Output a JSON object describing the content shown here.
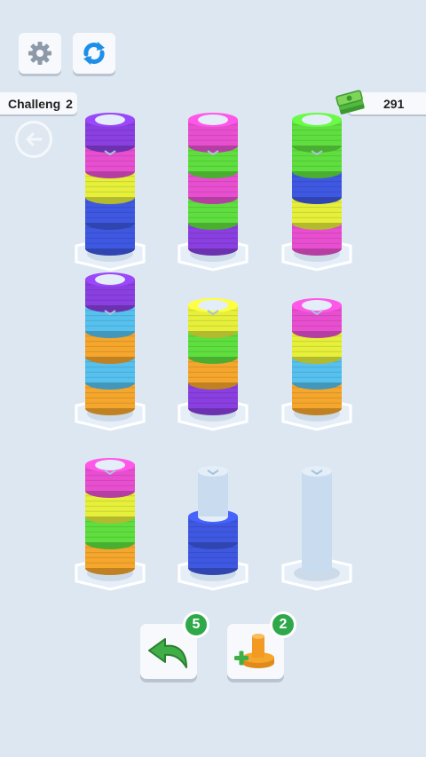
{
  "header": {
    "settings_icon": "gear-icon",
    "refresh_icon": "refresh-icon",
    "level_label": "Challeng",
    "level_number": "2",
    "cash_icon": "money-stack-icon",
    "cash_amount": "291",
    "back_icon": "arrow-left-icon"
  },
  "colors": {
    "purple": "#8a3fe0",
    "pink": "#e84fd0",
    "yellow": "#e6ef3a",
    "blue": "#3f58e2",
    "green": "#5fdf3f",
    "lightblue": "#56c1ee",
    "orange": "#f5a62c",
    "pole": "#c9dcef",
    "base": "#e6eff8",
    "accent_green": "#2fa84a"
  },
  "poles": [
    {
      "rings": [
        "blue",
        "blue",
        "yellow",
        "pink",
        "purple"
      ]
    },
    {
      "rings": [
        "purple",
        "green",
        "pink",
        "green",
        "pink"
      ]
    },
    {
      "rings": [
        "pink",
        "yellow",
        "blue",
        "green",
        "green"
      ]
    },
    {
      "rings": [
        "orange",
        "lightblue",
        "orange",
        "lightblue",
        "purple"
      ]
    },
    {
      "rings": [
        "purple",
        "orange",
        "green",
        "yellow"
      ]
    },
    {
      "rings": [
        "orange",
        "lightblue",
        "yellow",
        "pink"
      ]
    },
    {
      "rings": [
        "orange",
        "green",
        "yellow",
        "pink"
      ]
    },
    {
      "rings": [
        "blue",
        "blue"
      ]
    },
    {
      "rings": []
    }
  ],
  "actions": {
    "undo_icon": "undo-arrow-icon",
    "undo_count": "5",
    "add_pole_icon": "add-pole-icon",
    "add_pole_count": "2"
  }
}
